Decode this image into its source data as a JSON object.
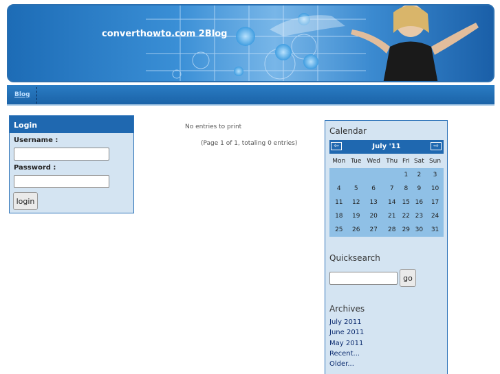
{
  "header": {
    "site_title": "converthowto.com 2Blog"
  },
  "nav": {
    "items": [
      {
        "label": "Blog"
      }
    ]
  },
  "login": {
    "title": "Login",
    "username_label": "Username :",
    "password_label": "Password :",
    "username_value": "",
    "password_value": "",
    "button_label": "login"
  },
  "main": {
    "no_entries": "No entries to print",
    "paging": "(Page 1 of 1, totaling 0 entries)"
  },
  "sidebar": {
    "calendar": {
      "title": "Calendar",
      "month": "July '11",
      "prev_icon": "arrow-left-icon",
      "next_icon": "arrow-right-icon",
      "weekdays": [
        "Mon",
        "Tue",
        "Wed",
        "Thu",
        "Fri",
        "Sat",
        "Sun"
      ],
      "weeks": [
        [
          "",
          "",
          "",
          "",
          "1",
          "2",
          "3"
        ],
        [
          "4",
          "5",
          "6",
          "7",
          "8",
          "9",
          "10"
        ],
        [
          "11",
          "12",
          "13",
          "14",
          "15",
          "16",
          "17"
        ],
        [
          "18",
          "19",
          "20",
          "21",
          "22",
          "23",
          "24"
        ],
        [
          "25",
          "26",
          "27",
          "28",
          "29",
          "30",
          "31"
        ]
      ]
    },
    "quicksearch": {
      "title": "Quicksearch",
      "value": "",
      "button_label": "go"
    },
    "archives": {
      "title": "Archives",
      "links": [
        "July 2011",
        "June 2011",
        "May 2011",
        "Recent...",
        "Older..."
      ]
    }
  }
}
